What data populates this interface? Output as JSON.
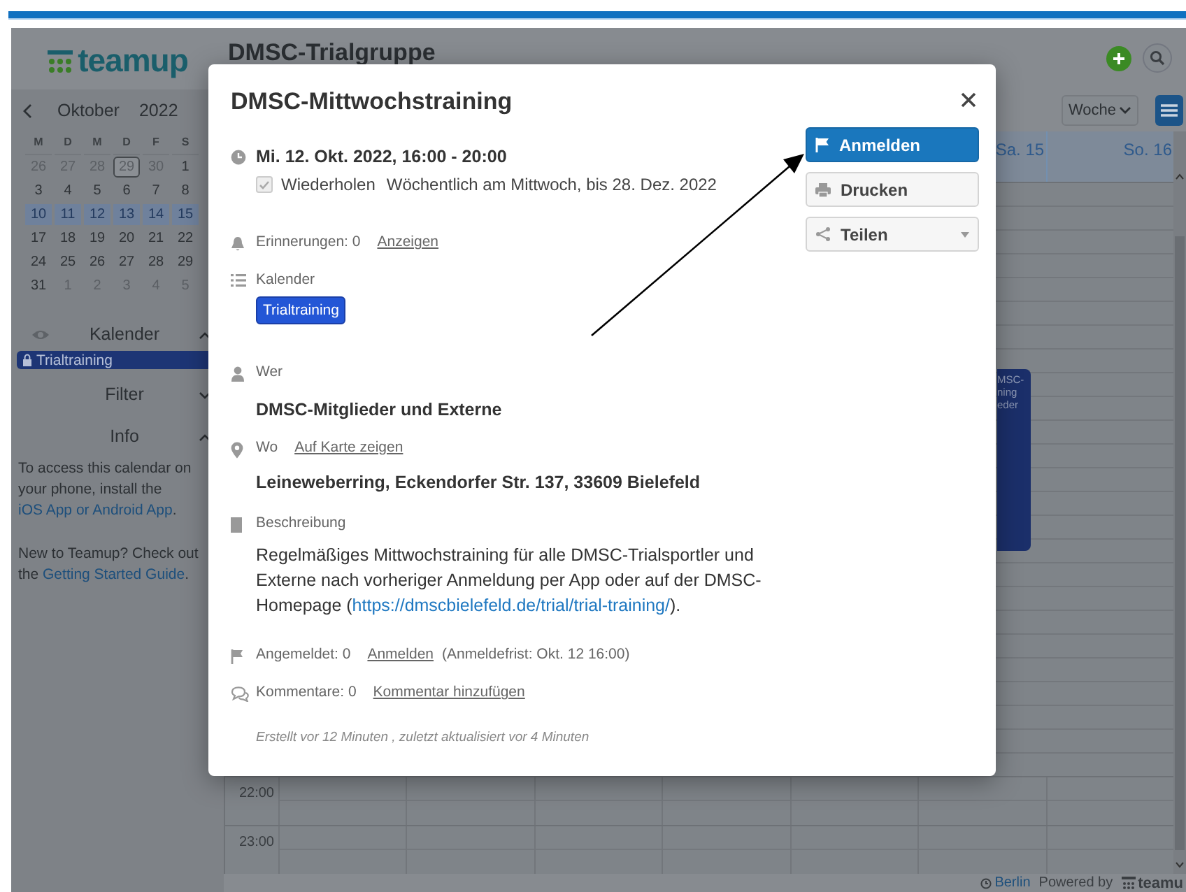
{
  "header": {
    "logo": "teamup",
    "title": "DMSC-Trialgruppe"
  },
  "mini_calendar": {
    "month": "Oktober",
    "year": "2022",
    "weekdays": [
      "M",
      "D",
      "M",
      "D",
      "F",
      "S"
    ],
    "weeks": [
      {
        "selected": false,
        "days": [
          {
            "label": "26",
            "in_month": false,
            "today": false
          },
          {
            "label": "27",
            "in_month": false,
            "today": false
          },
          {
            "label": "28",
            "in_month": false,
            "today": false
          },
          {
            "label": "29",
            "in_month": false,
            "today": true
          },
          {
            "label": "30",
            "in_month": false,
            "today": false
          },
          {
            "label": "1",
            "in_month": true,
            "today": false
          }
        ]
      },
      {
        "selected": false,
        "days": [
          {
            "label": "3",
            "in_month": true,
            "today": false
          },
          {
            "label": "4",
            "in_month": true,
            "today": false
          },
          {
            "label": "5",
            "in_month": true,
            "today": false
          },
          {
            "label": "6",
            "in_month": true,
            "today": false
          },
          {
            "label": "7",
            "in_month": true,
            "today": false
          },
          {
            "label": "8",
            "in_month": true,
            "today": false
          }
        ]
      },
      {
        "selected": true,
        "days": [
          {
            "label": "10",
            "in_month": true,
            "today": false
          },
          {
            "label": "11",
            "in_month": true,
            "today": false
          },
          {
            "label": "12",
            "in_month": true,
            "today": false
          },
          {
            "label": "13",
            "in_month": true,
            "today": false
          },
          {
            "label": "14",
            "in_month": true,
            "today": false
          },
          {
            "label": "15",
            "in_month": true,
            "today": false
          }
        ]
      },
      {
        "selected": false,
        "days": [
          {
            "label": "17",
            "in_month": true,
            "today": false
          },
          {
            "label": "18",
            "in_month": true,
            "today": false
          },
          {
            "label": "19",
            "in_month": true,
            "today": false
          },
          {
            "label": "20",
            "in_month": true,
            "today": false
          },
          {
            "label": "21",
            "in_month": true,
            "today": false
          },
          {
            "label": "22",
            "in_month": true,
            "today": false
          }
        ]
      },
      {
        "selected": false,
        "days": [
          {
            "label": "24",
            "in_month": true,
            "today": false
          },
          {
            "label": "25",
            "in_month": true,
            "today": false
          },
          {
            "label": "26",
            "in_month": true,
            "today": false
          },
          {
            "label": "27",
            "in_month": true,
            "today": false
          },
          {
            "label": "28",
            "in_month": true,
            "today": false
          },
          {
            "label": "29",
            "in_month": true,
            "today": false
          }
        ]
      },
      {
        "selected": false,
        "days": [
          {
            "label": "31",
            "in_month": true,
            "today": false
          },
          {
            "label": "1",
            "in_month": false,
            "today": false
          },
          {
            "label": "2",
            "in_month": false,
            "today": false
          },
          {
            "label": "3",
            "in_month": false,
            "today": false
          },
          {
            "label": "4",
            "in_month": false,
            "today": false
          },
          {
            "label": "5",
            "in_month": false,
            "today": false
          }
        ]
      }
    ]
  },
  "sidebar": {
    "sections": [
      {
        "kind": "calendars",
        "label": "Kalender",
        "expanded": true,
        "items": [
          {
            "label": "Trialtraining",
            "color": "#1d3575"
          }
        ]
      },
      {
        "kind": "filter",
        "label": "Filter",
        "expanded": false
      },
      {
        "kind": "info",
        "label": "Info",
        "expanded": true,
        "paragraphs": [
          {
            "before": "To access this calendar on your phone, install the ",
            "link": "iOS App or Android App",
            "after": "."
          },
          {
            "before": "New to Teamup? Check out the ",
            "link": "Getting Started Guide",
            "after": "."
          }
        ]
      }
    ]
  },
  "view": {
    "mode": "Woche",
    "day_headers": [
      "Sa. 15",
      "So. 16"
    ],
    "hours": [
      "22:00",
      "23:00"
    ],
    "event_fragment": [
      "MSC-",
      "ning",
      "eder"
    ]
  },
  "footer": {
    "timezone": "Berlin",
    "powered_by": "Powered by",
    "logo": "teamu"
  },
  "event_dialog": {
    "title": "DMSC-Mittwochstraining",
    "when": "Mi. 12. Okt. 2022, 16:00 - 20:00",
    "repeat": {
      "label": "Wiederholen",
      "checked": true,
      "rule": "Wöchentlich am Mittwoch, bis 28. Dez. 2022"
    },
    "reminders": {
      "label": "Erinnerungen: 0",
      "link": "Anzeigen"
    },
    "calendar": {
      "label": "Kalender",
      "tag": "Trialtraining",
      "color": "#2356d6"
    },
    "who": {
      "label": "Wer",
      "value": "DMSC-Mitglieder und Externe"
    },
    "where": {
      "label": "Wo",
      "link": "Auf Karte zeigen",
      "value": "Leineweberring, Eckendorfer Str. 137, 33609 Bielefeld"
    },
    "description": {
      "label": "Beschreibung",
      "before": "Regelmäßiges Mittwochstraining für alle DMSC-Trialsportler und Externe nach vorheriger Anmeldung per App oder auf der DMSC-Homepage (",
      "link": "https://dmscbielefeld.de/trial/trial-training/",
      "after": ")."
    },
    "signup": {
      "label": "Angemeldet: 0",
      "link": "Anmelden",
      "note": "(Anmeldefrist: Okt. 12 16:00)"
    },
    "comments": {
      "label": "Kommentare: 0",
      "link": "Kommentar hinzufügen"
    },
    "meta": "Erstellt vor 12 Minuten , zuletzt aktualisiert vor 4 Minuten",
    "buttons": [
      {
        "label": "Anmelden",
        "primary": true,
        "dropdown": false
      },
      {
        "label": "Drucken",
        "primary": false,
        "dropdown": false
      },
      {
        "label": "Teilen",
        "primary": false,
        "dropdown": true
      }
    ]
  }
}
